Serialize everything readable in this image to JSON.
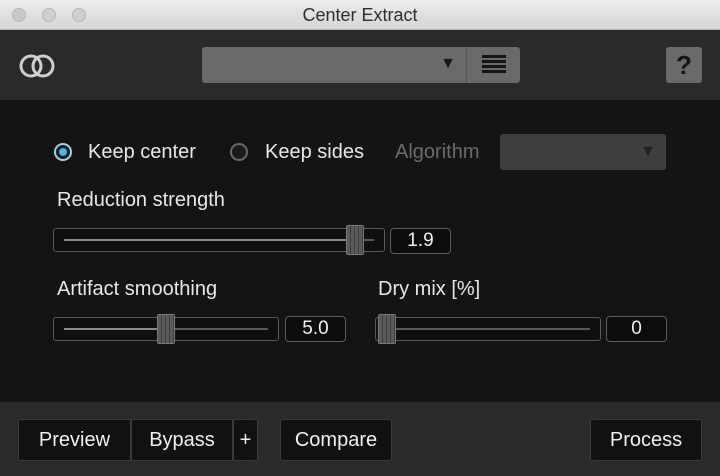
{
  "window": {
    "title": "Center Extract"
  },
  "header": {
    "preset_value": "",
    "icons": {
      "logo": "dual-circle-logo-icon",
      "preset_arrow": "triangle-down-icon",
      "menu": "hamburger-menu-icon",
      "help": "question-mark-icon"
    },
    "help_label": "?"
  },
  "mode": {
    "options": [
      {
        "label": "Keep center",
        "selected": true
      },
      {
        "label": "Keep sides",
        "selected": false
      }
    ],
    "algorithm_label": "Algorithm",
    "algorithm_value": ""
  },
  "controls": {
    "reduction": {
      "label": "Reduction strength",
      "value": "1.9",
      "position": 0.94
    },
    "artifact": {
      "label": "Artifact smoothing",
      "value": "5.0",
      "position": 0.5
    },
    "drymix": {
      "label": "Dry mix [%]",
      "value": "0",
      "position": 0.0
    }
  },
  "footer": {
    "preview": "Preview",
    "bypass": "Bypass",
    "plus": "+",
    "compare": "Compare",
    "process": "Process"
  },
  "colors": {
    "accent": "#4ab1ea",
    "panel": "#141414",
    "header": "#2a2a2a"
  }
}
